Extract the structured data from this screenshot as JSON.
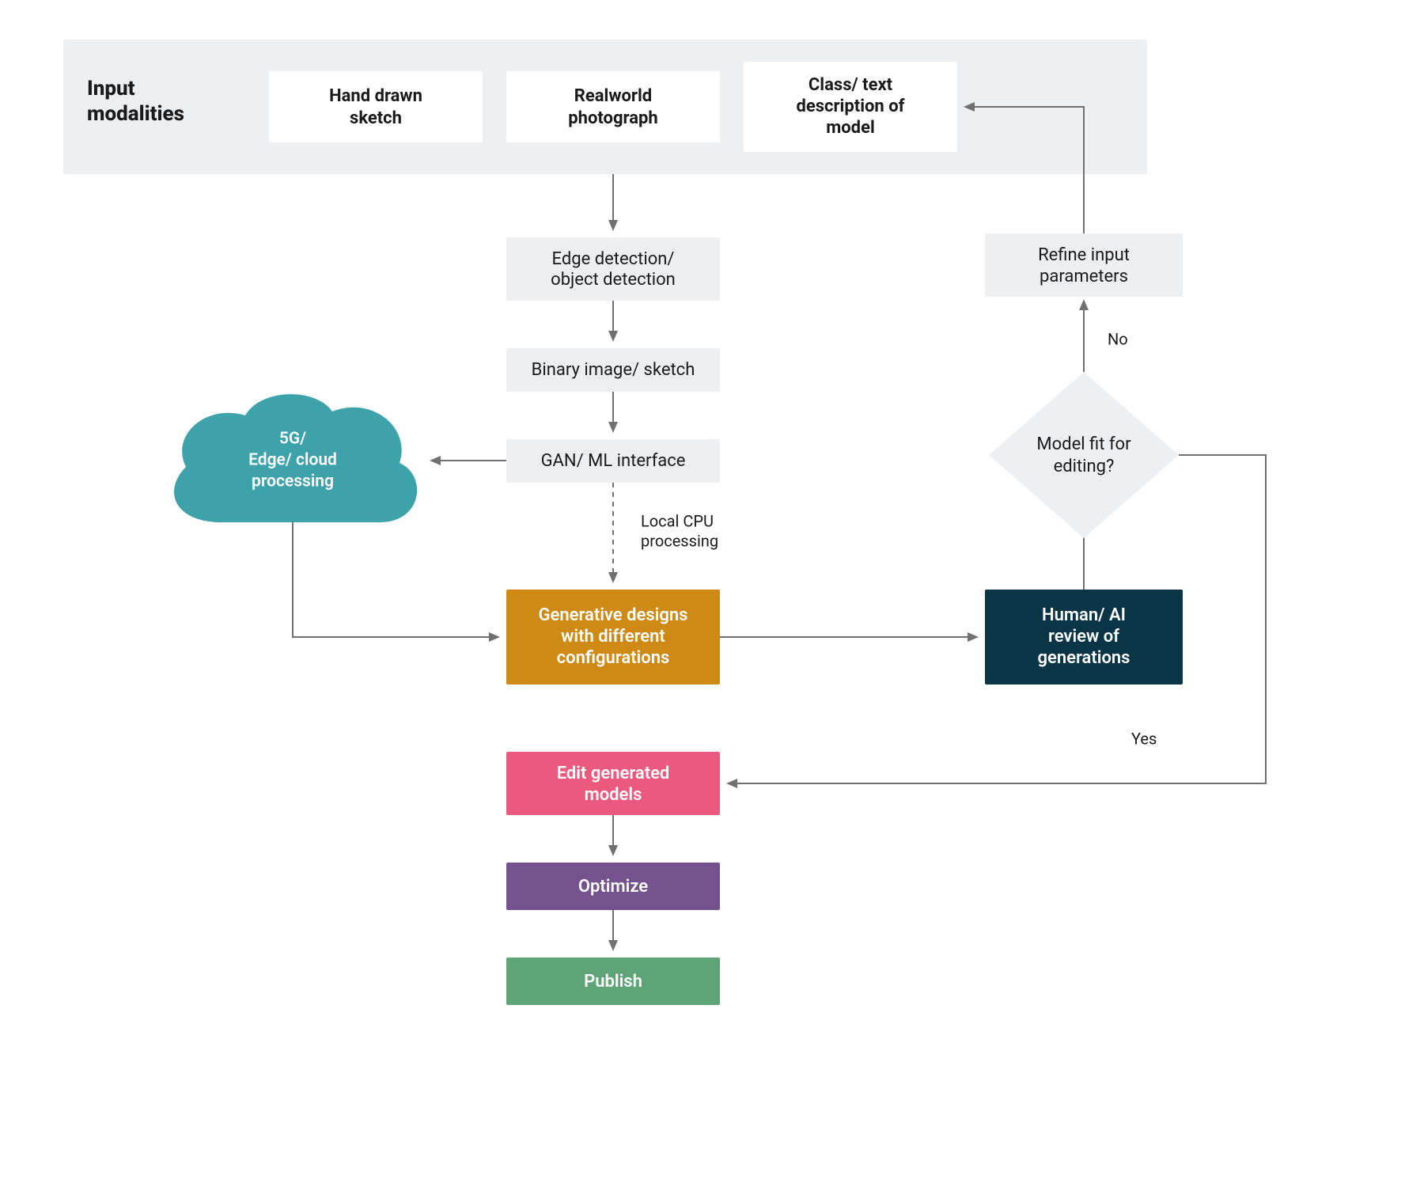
{
  "header": {
    "title_l1": "Input",
    "title_l2": "modalities",
    "items": {
      "sketch_l1": "Hand drawn",
      "sketch_l2": "sketch",
      "photo_l1": "Realworld",
      "photo_l2": "photograph",
      "text_l1": "Class/ text",
      "text_l2": "description of",
      "text_l3": "model"
    }
  },
  "nodes": {
    "edge_l1": "Edge detection/",
    "edge_l2": "object detection",
    "binary": "Binary image/ sketch",
    "gan": "GAN/ ML interface",
    "cloud_l1": "5G/",
    "cloud_l2": "Edge/ cloud",
    "cloud_l3": "processing",
    "gen_l1": "Generative designs",
    "gen_l2": "with different",
    "gen_l3": "configurations",
    "review_l1": "Human/ AI",
    "review_l2": "review of",
    "review_l3": "generations",
    "fit_l1": "Model fit for",
    "fit_l2": "editing?",
    "refine_l1": "Refine input",
    "refine_l2": "parameters",
    "edit_l1": "Edit generated",
    "edit_l2": "models",
    "optimize": "Optimize",
    "publish": "Publish"
  },
  "labels": {
    "local_cpu_l1": "Local CPU",
    "local_cpu_l2": "processing",
    "no": "No",
    "yes": "Yes"
  },
  "colors": {
    "panel_grey": "#edf0f3",
    "white": "#ffffff",
    "teal": "#3ea2ab",
    "orange": "#ce8a15",
    "dark_navy": "#093547",
    "pink": "#eb5a7e",
    "purple": "#75528e",
    "green": "#5fa477",
    "arrow": "#707070"
  }
}
